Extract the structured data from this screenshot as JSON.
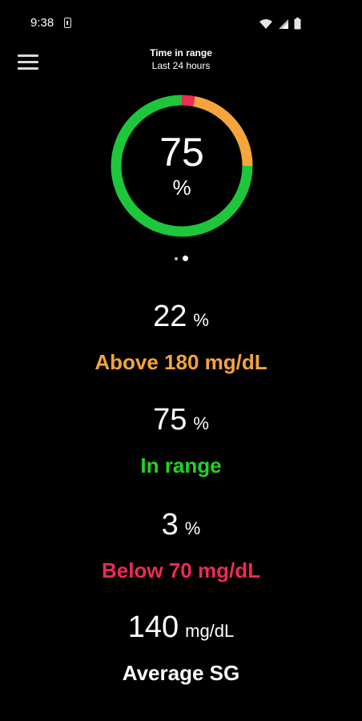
{
  "status_bar": {
    "time": "9:38",
    "icons": [
      "sim-card-icon",
      "wifi-icon",
      "signal-icon",
      "battery-icon"
    ]
  },
  "header": {
    "title": "Time in range",
    "subtitle": "Last 24 hours",
    "menu_icon": "hamburger-menu-icon"
  },
  "ring": {
    "value": "75",
    "unit": "%",
    "segments": [
      {
        "name": "in-range",
        "percent": 75,
        "color": "#1ec63c"
      },
      {
        "name": "above",
        "percent": 22,
        "color": "#f5a53b"
      },
      {
        "name": "below",
        "percent": 3,
        "color": "#ef2a55"
      }
    ]
  },
  "page_indicator": {
    "count": 2,
    "active": 2
  },
  "stats": {
    "above": {
      "value": "22",
      "unit": "%",
      "label": "Above 180 mg/dL",
      "color": "#f5a53b"
    },
    "in_range": {
      "value": "75",
      "unit": "%",
      "label": "In range",
      "color": "#22d321"
    },
    "below": {
      "value": "3",
      "unit": "%",
      "label": "Below 70 mg/dL",
      "color": "#ef2a55"
    },
    "average": {
      "value": "140",
      "unit": "mg/dL",
      "label": "Average SG",
      "color": "#ffffff"
    }
  }
}
